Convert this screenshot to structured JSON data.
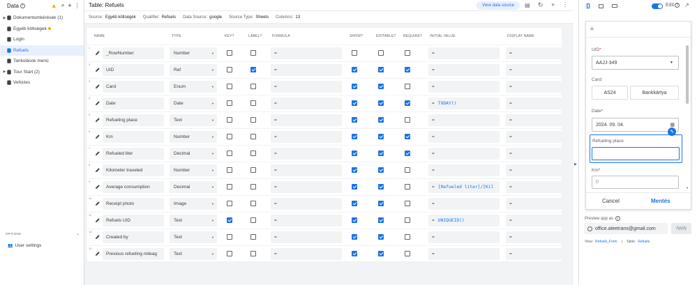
{
  "sidebar": {
    "title": "Data",
    "items": [
      {
        "label": "Dokumentumkérések (1)",
        "expandable": true,
        "active": false
      },
      {
        "label": "Egyéb költségek",
        "expandable": false,
        "active": false,
        "dot": true
      },
      {
        "label": "Login",
        "expandable": false,
        "active": false
      },
      {
        "label": "Refuels",
        "expandable": false,
        "active": true
      },
      {
        "label": "Tankolások menü",
        "expandable": false,
        "active": false
      },
      {
        "label": "Tour Start (2)",
        "expandable": true,
        "active": false
      },
      {
        "label": "Vehicles",
        "expandable": false,
        "active": false
      }
    ],
    "options_label": "OPTIONS",
    "user_settings": "User settings"
  },
  "main": {
    "title": "Table: Refuels",
    "view_source_label": "View data source",
    "meta": [
      {
        "key": "Source:",
        "value": "Egyéb költségek"
      },
      {
        "key": "Qualifier:",
        "value": "Refuels"
      },
      {
        "key": "Data Source:",
        "value": "google"
      },
      {
        "key": "Source Type:",
        "value": "Sheets"
      },
      {
        "key": "Columns:",
        "value": "13"
      }
    ],
    "headers": {
      "name": "NAME",
      "type": "TYPE",
      "key": "KEY?",
      "label": "LABEL?",
      "formula": "FORMULA",
      "show": "SHOW?",
      "editable": "EDITABLE?",
      "require": "REQUIRE?",
      "initial": "INITIAL VALUE",
      "display": "DISPLAY NAME"
    },
    "rows": [
      {
        "n": "1",
        "name": "_RowNumber",
        "type": "Number",
        "key": false,
        "label": false,
        "show": false,
        "editable": false,
        "require": false,
        "initial": ""
      },
      {
        "n": "2",
        "name": "UID",
        "type": "Ref",
        "key": false,
        "label": true,
        "show": true,
        "editable": true,
        "require": true,
        "initial": ""
      },
      {
        "n": "3",
        "name": "Card",
        "type": "Enum",
        "key": false,
        "label": false,
        "show": true,
        "editable": true,
        "require": false,
        "initial": ""
      },
      {
        "n": "4",
        "name": "Date",
        "type": "Date",
        "key": false,
        "label": false,
        "show": true,
        "editable": true,
        "require": true,
        "initial": "TODAY()"
      },
      {
        "n": "5",
        "name": "Refueling place",
        "type": "Text",
        "key": false,
        "label": false,
        "show": true,
        "editable": true,
        "require": false,
        "initial": ""
      },
      {
        "n": "6",
        "name": "Km",
        "type": "Number",
        "key": false,
        "label": false,
        "show": true,
        "editable": true,
        "require": true,
        "initial": ""
      },
      {
        "n": "7",
        "name": "Refueled liter",
        "type": "Decimal",
        "key": false,
        "label": false,
        "show": true,
        "editable": true,
        "require": true,
        "initial": ""
      },
      {
        "n": "8",
        "name": "Kilometer traveled",
        "type": "Number",
        "key": false,
        "label": false,
        "show": true,
        "editable": true,
        "require": false,
        "initial": ""
      },
      {
        "n": "9",
        "name": "Average consumption",
        "type": "Decimal",
        "key": false,
        "label": false,
        "show": true,
        "editable": true,
        "require": false,
        "initial": "[Refueled liter]/[Kil"
      },
      {
        "n": "10",
        "name": "Receipt photo",
        "type": "Image",
        "key": false,
        "label": false,
        "show": true,
        "editable": true,
        "require": false,
        "initial": ""
      },
      {
        "n": "11",
        "name": "Refuels UID",
        "type": "Text",
        "key": true,
        "label": false,
        "show": true,
        "editable": true,
        "require": false,
        "initial": "UNIQUEID()"
      },
      {
        "n": "12",
        "name": "Created by",
        "type": "Text",
        "key": false,
        "label": false,
        "show": true,
        "editable": true,
        "require": false,
        "initial": ""
      },
      {
        "n": "13",
        "name": "Previous refueling mileag",
        "type": "Text",
        "key": false,
        "label": false,
        "show": true,
        "editable": true,
        "require": false,
        "initial": ""
      }
    ],
    "eq": "="
  },
  "right": {
    "edit_label": "Edit",
    "form": {
      "uid_label": "UID",
      "uid_value": "AAJJ-349",
      "card_label": "Card",
      "card_options": [
        "AS24",
        "Bankkártya"
      ],
      "date_label": "Date",
      "date_value": "2024. 09. 04.",
      "place_label": "Refueling place",
      "km_label": "Km",
      "km_value": "0",
      "cancel": "Cancel",
      "save": "Mentés"
    },
    "preview_as_label": "Preview app as",
    "preview_email": "office.ateetrans@gmail.com",
    "apply": "Apply",
    "view_label": "View:",
    "view_value": "Refuels_Form",
    "table_label": "Table:",
    "table_value": "Refuels",
    "sep": "|"
  },
  "colors": {
    "accent": "#1a73e8",
    "warning": "#f9ab00",
    "active_bg": "#e8f0fe"
  }
}
